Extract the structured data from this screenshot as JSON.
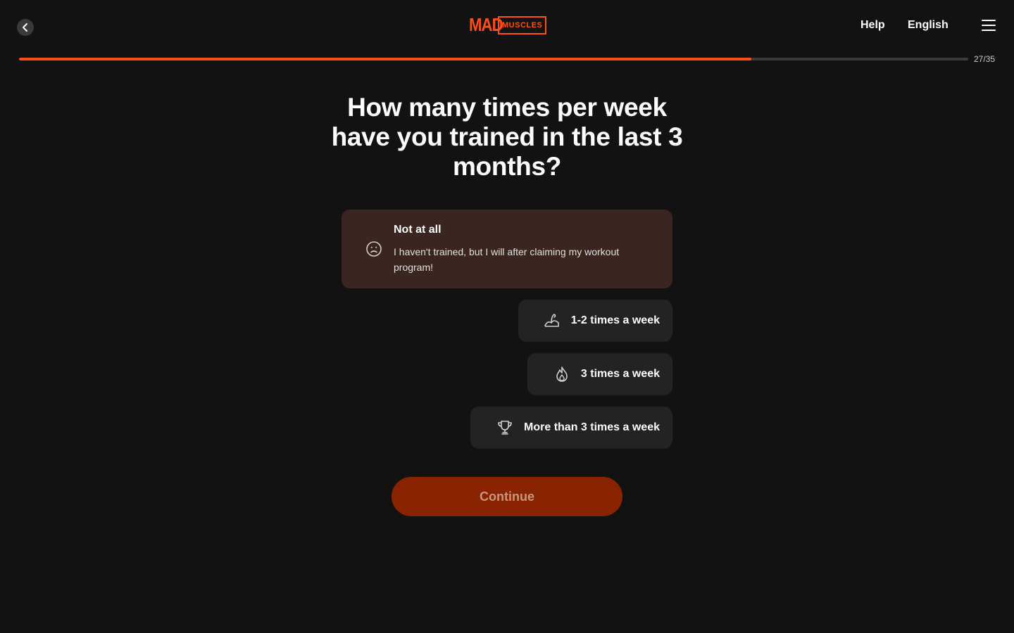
{
  "header": {
    "logo_mad": "MAD",
    "logo_muscles": "MUSCLES",
    "help": "Help",
    "language": "English",
    "back_icon": "chevron-left-icon",
    "menu_icon": "hamburger-menu-icon"
  },
  "progress": {
    "current": 27,
    "total": 35,
    "label": "27/35",
    "fraction": 0.7714
  },
  "question": "How many times per week have you trained in the last 3 months?",
  "options": [
    {
      "title": "Not at all",
      "description": "I haven't trained, but I will after claiming my workout program!",
      "icon": "sad-face-icon",
      "selected": true
    },
    {
      "label": "1-2 times a week",
      "icon": "flexed-arm-icon"
    },
    {
      "label": "3 times a week",
      "icon": "flame-icon"
    },
    {
      "label": "More than 3 times a week",
      "icon": "trophy-icon"
    }
  ],
  "continue_label": "Continue",
  "colors": {
    "accent": "#ff4e12",
    "background": "#121212",
    "option_bg": "#232323",
    "option_selected_bg": "#3a2520",
    "continue_bg": "#8a2300"
  }
}
